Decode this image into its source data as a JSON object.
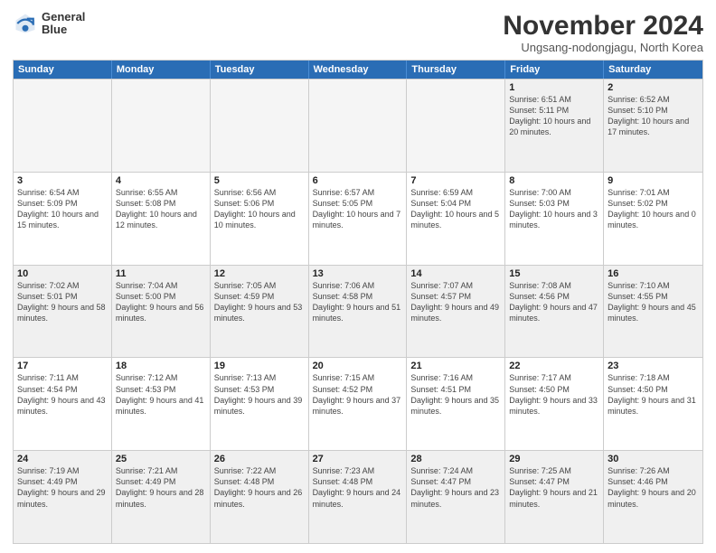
{
  "logo": {
    "line1": "General",
    "line2": "Blue"
  },
  "title": "November 2024",
  "subtitle": "Ungsang-nodongjagu, North Korea",
  "header_days": [
    "Sunday",
    "Monday",
    "Tuesday",
    "Wednesday",
    "Thursday",
    "Friday",
    "Saturday"
  ],
  "weeks": [
    [
      {
        "day": "",
        "info": ""
      },
      {
        "day": "",
        "info": ""
      },
      {
        "day": "",
        "info": ""
      },
      {
        "day": "",
        "info": ""
      },
      {
        "day": "",
        "info": ""
      },
      {
        "day": "1",
        "info": "Sunrise: 6:51 AM\nSunset: 5:11 PM\nDaylight: 10 hours\nand 20 minutes."
      },
      {
        "day": "2",
        "info": "Sunrise: 6:52 AM\nSunset: 5:10 PM\nDaylight: 10 hours\nand 17 minutes."
      }
    ],
    [
      {
        "day": "3",
        "info": "Sunrise: 6:54 AM\nSunset: 5:09 PM\nDaylight: 10 hours\nand 15 minutes."
      },
      {
        "day": "4",
        "info": "Sunrise: 6:55 AM\nSunset: 5:08 PM\nDaylight: 10 hours\nand 12 minutes."
      },
      {
        "day": "5",
        "info": "Sunrise: 6:56 AM\nSunset: 5:06 PM\nDaylight: 10 hours\nand 10 minutes."
      },
      {
        "day": "6",
        "info": "Sunrise: 6:57 AM\nSunset: 5:05 PM\nDaylight: 10 hours\nand 7 minutes."
      },
      {
        "day": "7",
        "info": "Sunrise: 6:59 AM\nSunset: 5:04 PM\nDaylight: 10 hours\nand 5 minutes."
      },
      {
        "day": "8",
        "info": "Sunrise: 7:00 AM\nSunset: 5:03 PM\nDaylight: 10 hours\nand 3 minutes."
      },
      {
        "day": "9",
        "info": "Sunrise: 7:01 AM\nSunset: 5:02 PM\nDaylight: 10 hours\nand 0 minutes."
      }
    ],
    [
      {
        "day": "10",
        "info": "Sunrise: 7:02 AM\nSunset: 5:01 PM\nDaylight: 9 hours\nand 58 minutes."
      },
      {
        "day": "11",
        "info": "Sunrise: 7:04 AM\nSunset: 5:00 PM\nDaylight: 9 hours\nand 56 minutes."
      },
      {
        "day": "12",
        "info": "Sunrise: 7:05 AM\nSunset: 4:59 PM\nDaylight: 9 hours\nand 53 minutes."
      },
      {
        "day": "13",
        "info": "Sunrise: 7:06 AM\nSunset: 4:58 PM\nDaylight: 9 hours\nand 51 minutes."
      },
      {
        "day": "14",
        "info": "Sunrise: 7:07 AM\nSunset: 4:57 PM\nDaylight: 9 hours\nand 49 minutes."
      },
      {
        "day": "15",
        "info": "Sunrise: 7:08 AM\nSunset: 4:56 PM\nDaylight: 9 hours\nand 47 minutes."
      },
      {
        "day": "16",
        "info": "Sunrise: 7:10 AM\nSunset: 4:55 PM\nDaylight: 9 hours\nand 45 minutes."
      }
    ],
    [
      {
        "day": "17",
        "info": "Sunrise: 7:11 AM\nSunset: 4:54 PM\nDaylight: 9 hours\nand 43 minutes."
      },
      {
        "day": "18",
        "info": "Sunrise: 7:12 AM\nSunset: 4:53 PM\nDaylight: 9 hours\nand 41 minutes."
      },
      {
        "day": "19",
        "info": "Sunrise: 7:13 AM\nSunset: 4:53 PM\nDaylight: 9 hours\nand 39 minutes."
      },
      {
        "day": "20",
        "info": "Sunrise: 7:15 AM\nSunset: 4:52 PM\nDaylight: 9 hours\nand 37 minutes."
      },
      {
        "day": "21",
        "info": "Sunrise: 7:16 AM\nSunset: 4:51 PM\nDaylight: 9 hours\nand 35 minutes."
      },
      {
        "day": "22",
        "info": "Sunrise: 7:17 AM\nSunset: 4:50 PM\nDaylight: 9 hours\nand 33 minutes."
      },
      {
        "day": "23",
        "info": "Sunrise: 7:18 AM\nSunset: 4:50 PM\nDaylight: 9 hours\nand 31 minutes."
      }
    ],
    [
      {
        "day": "24",
        "info": "Sunrise: 7:19 AM\nSunset: 4:49 PM\nDaylight: 9 hours\nand 29 minutes."
      },
      {
        "day": "25",
        "info": "Sunrise: 7:21 AM\nSunset: 4:49 PM\nDaylight: 9 hours\nand 28 minutes."
      },
      {
        "day": "26",
        "info": "Sunrise: 7:22 AM\nSunset: 4:48 PM\nDaylight: 9 hours\nand 26 minutes."
      },
      {
        "day": "27",
        "info": "Sunrise: 7:23 AM\nSunset: 4:48 PM\nDaylight: 9 hours\nand 24 minutes."
      },
      {
        "day": "28",
        "info": "Sunrise: 7:24 AM\nSunset: 4:47 PM\nDaylight: 9 hours\nand 23 minutes."
      },
      {
        "day": "29",
        "info": "Sunrise: 7:25 AM\nSunset: 4:47 PM\nDaylight: 9 hours\nand 21 minutes."
      },
      {
        "day": "30",
        "info": "Sunrise: 7:26 AM\nSunset: 4:46 PM\nDaylight: 9 hours\nand 20 minutes."
      }
    ]
  ]
}
